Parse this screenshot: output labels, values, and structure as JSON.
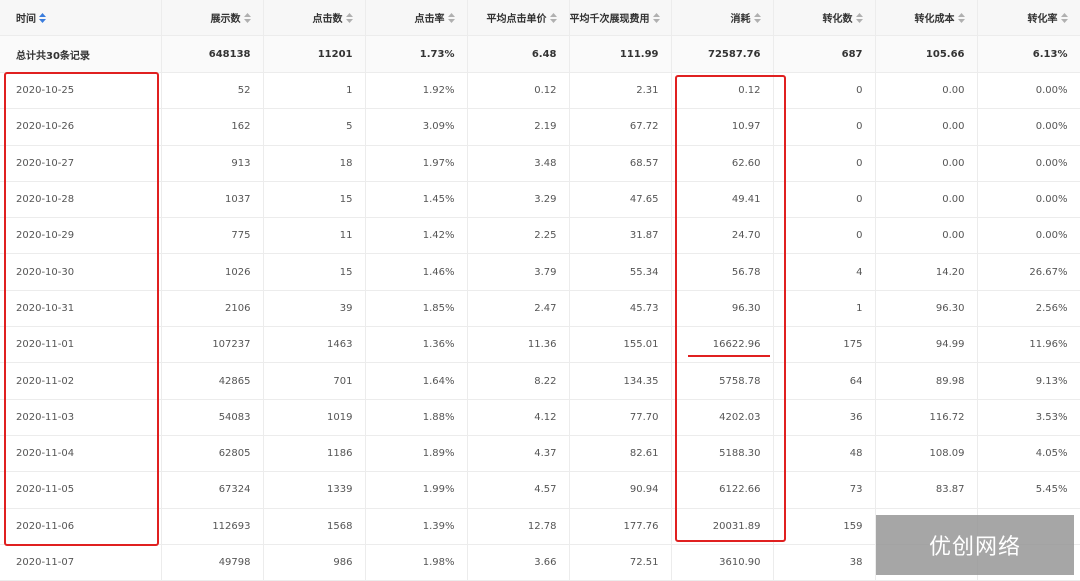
{
  "columns": [
    {
      "label": "时间",
      "active": true
    },
    {
      "label": "展示数",
      "active": false
    },
    {
      "label": "点击数",
      "active": false
    },
    {
      "label": "点击率",
      "active": false
    },
    {
      "label": "平均点击单价",
      "active": false
    },
    {
      "label": "平均千次展现费用",
      "active": false
    },
    {
      "label": "消耗",
      "active": false
    },
    {
      "label": "转化数",
      "active": false
    },
    {
      "label": "转化成本",
      "active": false
    },
    {
      "label": "转化率",
      "active": false
    }
  ],
  "summary": [
    "总计共30条记录",
    "648138",
    "11201",
    "1.73%",
    "6.48",
    "111.99",
    "72587.76",
    "687",
    "105.66",
    "6.13%"
  ],
  "rows": [
    [
      "2020-10-25",
      "52",
      "1",
      "1.92%",
      "0.12",
      "2.31",
      "0.12",
      "0",
      "0.00",
      "0.00%"
    ],
    [
      "2020-10-26",
      "162",
      "5",
      "3.09%",
      "2.19",
      "67.72",
      "10.97",
      "0",
      "0.00",
      "0.00%"
    ],
    [
      "2020-10-27",
      "913",
      "18",
      "1.97%",
      "3.48",
      "68.57",
      "62.60",
      "0",
      "0.00",
      "0.00%"
    ],
    [
      "2020-10-28",
      "1037",
      "15",
      "1.45%",
      "3.29",
      "47.65",
      "49.41",
      "0",
      "0.00",
      "0.00%"
    ],
    [
      "2020-10-29",
      "775",
      "11",
      "1.42%",
      "2.25",
      "31.87",
      "24.70",
      "0",
      "0.00",
      "0.00%"
    ],
    [
      "2020-10-30",
      "1026",
      "15",
      "1.46%",
      "3.79",
      "55.34",
      "56.78",
      "4",
      "14.20",
      "26.67%"
    ],
    [
      "2020-10-31",
      "2106",
      "39",
      "1.85%",
      "2.47",
      "45.73",
      "96.30",
      "1",
      "96.30",
      "2.56%"
    ],
    [
      "2020-11-01",
      "107237",
      "1463",
      "1.36%",
      "11.36",
      "155.01",
      "16622.96",
      "175",
      "94.99",
      "11.96%"
    ],
    [
      "2020-11-02",
      "42865",
      "701",
      "1.64%",
      "8.22",
      "134.35",
      "5758.78",
      "64",
      "89.98",
      "9.13%"
    ],
    [
      "2020-11-03",
      "54083",
      "1019",
      "1.88%",
      "4.12",
      "77.70",
      "4202.03",
      "36",
      "116.72",
      "3.53%"
    ],
    [
      "2020-11-04",
      "62805",
      "1186",
      "1.89%",
      "4.37",
      "82.61",
      "5188.30",
      "48",
      "108.09",
      "4.05%"
    ],
    [
      "2020-11-05",
      "67324",
      "1339",
      "1.99%",
      "4.57",
      "90.94",
      "6122.66",
      "73",
      "83.87",
      "5.45%"
    ],
    [
      "2020-11-06",
      "112693",
      "1568",
      "1.39%",
      "12.78",
      "177.76",
      "20031.89",
      "159",
      "",
      ""
    ],
    [
      "2020-11-07",
      "49798",
      "986",
      "1.98%",
      "3.66",
      "72.51",
      "3610.90",
      "38",
      "",
      ""
    ]
  ],
  "watermark": "优创网络",
  "colors": {
    "annotation": "#e02020",
    "sort_inactive": "#b0b0b0",
    "sort_active": "#3b7ddd"
  }
}
